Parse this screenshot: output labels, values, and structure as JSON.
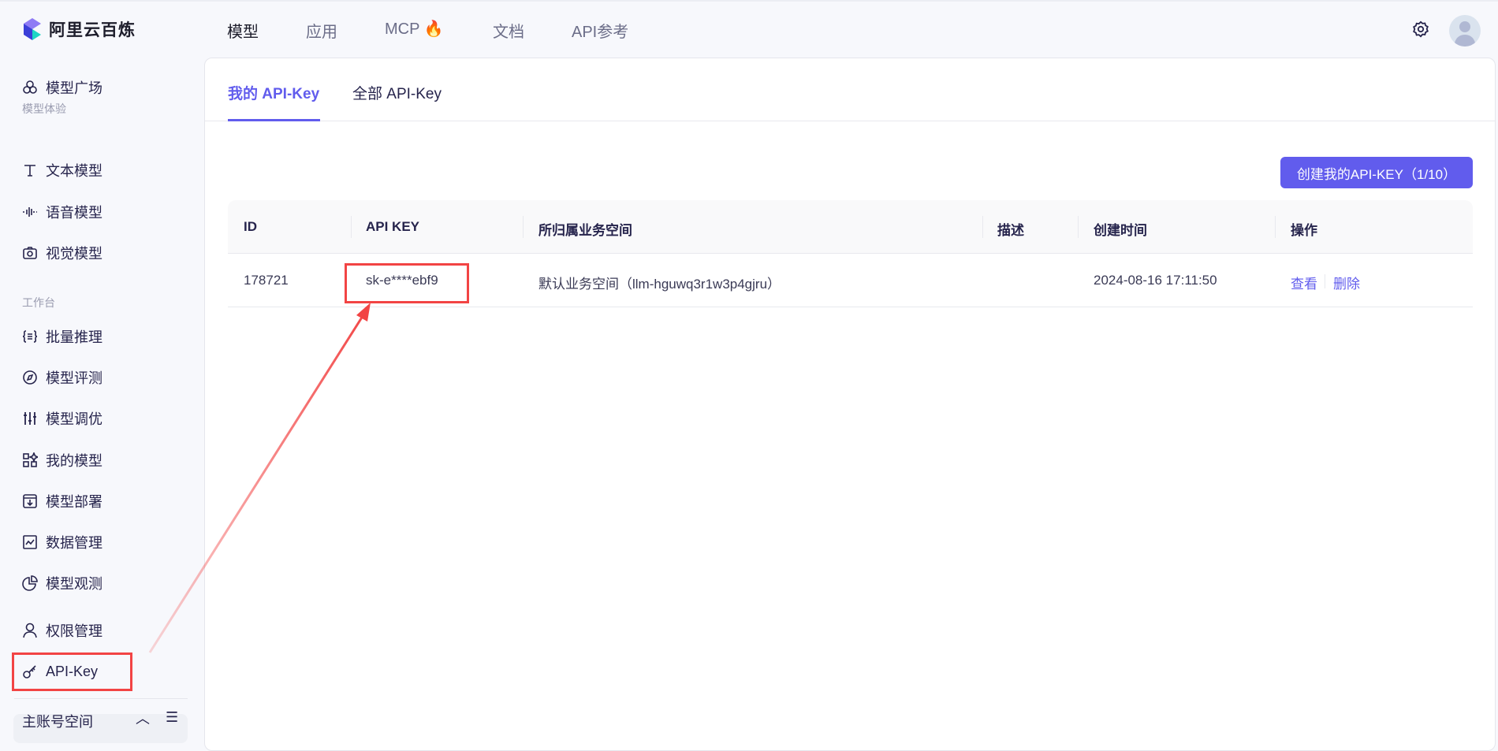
{
  "header": {
    "brand": "阿里云百炼",
    "nav": [
      "模型",
      "应用",
      "MCP",
      "文档",
      "API参考"
    ],
    "mcp_badge_icon": "fire-icon"
  },
  "sidebar": {
    "items": [
      {
        "label": "模型广场",
        "icon": "model-square-icon"
      },
      {
        "section": "模型体验"
      },
      {
        "label": "文本模型",
        "icon": "text-icon"
      },
      {
        "label": "语音模型",
        "icon": "waveform-icon"
      },
      {
        "label": "视觉模型",
        "icon": "camera-icon"
      },
      {
        "section": "工作台"
      },
      {
        "label": "批量推理",
        "icon": "braces-icon"
      },
      {
        "label": "模型评测",
        "icon": "compass-icon"
      },
      {
        "label": "模型调优",
        "icon": "sliders-icon"
      },
      {
        "label": "我的模型",
        "icon": "grid-icon"
      },
      {
        "label": "模型部署",
        "icon": "download-box-icon"
      },
      {
        "label": "数据管理",
        "icon": "chart-icon"
      },
      {
        "label": "模型观测",
        "icon": "pie-icon"
      },
      {
        "label": "权限管理",
        "icon": "user-icon"
      },
      {
        "label": "API-Key",
        "icon": "key-icon"
      }
    ],
    "footer": "主账号空间"
  },
  "tabs": [
    "我的 API-Key",
    "全部 API-Key"
  ],
  "create_button": "创建我的API-KEY（1/10）",
  "table": {
    "columns": [
      "ID",
      "API KEY",
      "所归属业务空间",
      "描述",
      "创建时间",
      "操作"
    ],
    "rows": [
      {
        "id": "178721",
        "key": "sk-e****ebf9",
        "workspace": "默认业务空间（llm-hguwq3r1w3p4gjru）",
        "desc": "",
        "created": "2024-08-16 17:11:50",
        "actions": [
          "查看",
          "删除"
        ]
      }
    ]
  },
  "colors": {
    "primary": "#615ced",
    "annotation": "#f24444"
  }
}
